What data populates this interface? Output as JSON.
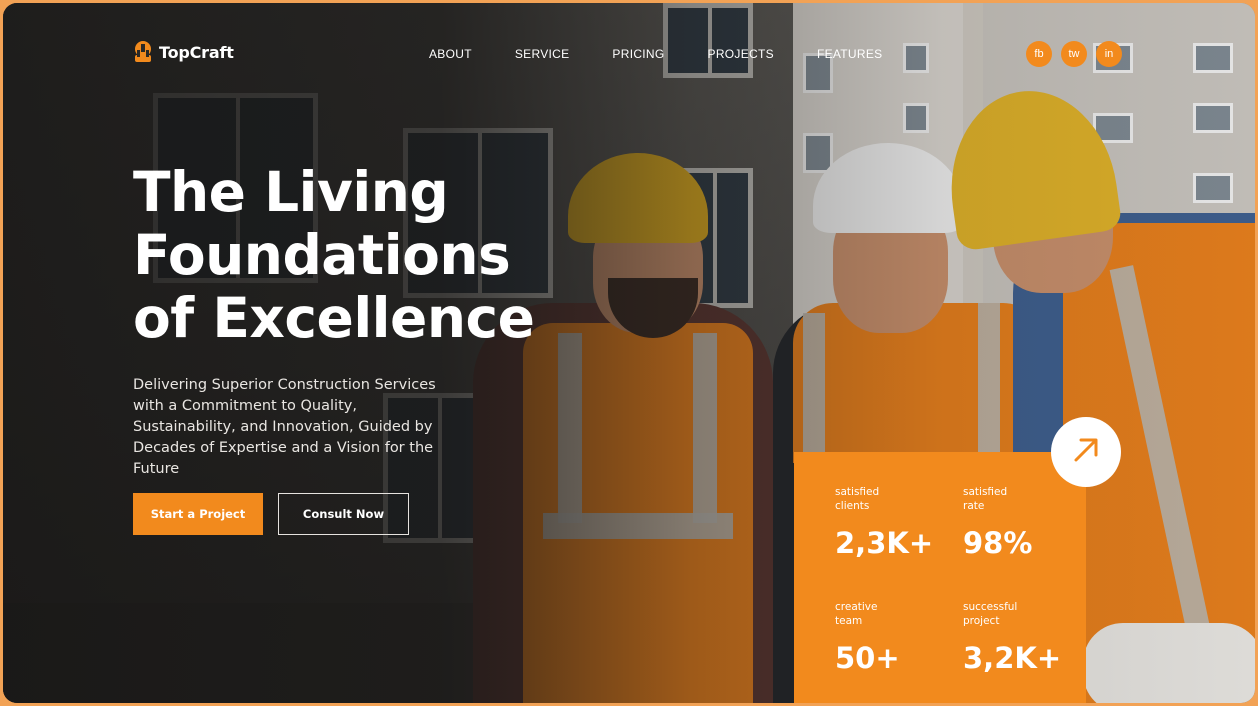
{
  "brand": {
    "name": "TopCraft",
    "accent": "#f28a1d"
  },
  "nav": {
    "items": [
      "ABOUT",
      "SERVICE",
      "PRICING",
      "PROJECTS",
      "FEATURES"
    ],
    "social": [
      "fb",
      "tw",
      "in"
    ]
  },
  "hero": {
    "title_lines": [
      "The Living",
      "Foundations",
      "of Excellence"
    ],
    "subtitle": "Delivering Superior Construction Services with a Commitment to Quality, Sustainability, and Innovation, Guided by Decades of Expertise and a Vision for the Future",
    "primary_button": "Start a Project",
    "secondary_button": "Consult Now"
  },
  "stats": [
    {
      "label_line1": "satisfied",
      "label_line2": "clients",
      "value": "2,3K+"
    },
    {
      "label_line1": "satisfied",
      "label_line2": "rate",
      "value": "98%"
    },
    {
      "label_line1": "creative",
      "label_line2": "team",
      "value": "50+"
    },
    {
      "label_line1": "successful",
      "label_line2": "project",
      "value": "3,2K+"
    }
  ],
  "icons": {
    "logo": "hardhat-logo-icon",
    "arrow": "arrow-up-right-icon"
  }
}
